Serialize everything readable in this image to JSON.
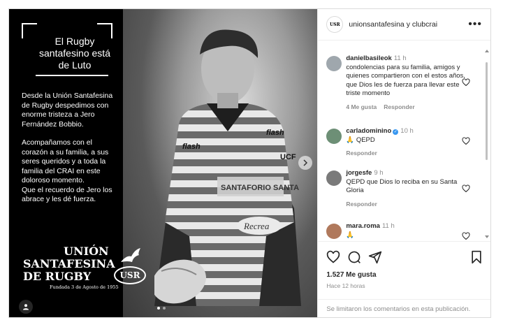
{
  "post": {
    "overlay_title": "El Rugby santafesino está de Luto",
    "paragraph1": "Desde la Unión Santafesina de Rugby despedimos con enorme tristeza a Jero Fernández Bobbio.",
    "paragraph2": "Acompañamos con el corazón a su familia, a sus seres queridos y a toda la familia del CRAI en este doloroso momento.",
    "paragraph3": "Que el recuerdo de Jero los abrace y les dé fuerza.",
    "logo": {
      "line1": "UNIÓN",
      "line2": "SANTAFESINA",
      "line3": "DE RUGBY",
      "badge": "USR",
      "founded": "Fundada 3 de Agosto de 1955"
    },
    "jersey": {
      "brand": "flash",
      "chest": "SANTAFORIO SANTA FE",
      "sponsor": "Recrea",
      "sleeve": "UCF"
    }
  },
  "header": {
    "author": "unionsantafesina",
    "connector": "y",
    "collaborator": "clubcrai",
    "avatar_text": "USR",
    "more_label": "•••"
  },
  "comments": [
    {
      "user": "danielbasileok",
      "time": "11 h",
      "text": "condolencias para su familia, amigos y quienes compartieron con el estos años, que Dios les de fuerza para llevar este triste momento",
      "likes": "4 Me gusta",
      "reply": "Responder"
    },
    {
      "user": "carladominino",
      "verified": true,
      "time": "10 h",
      "text": "🙏 QEPD",
      "reply": "Responder"
    },
    {
      "user": "jorgesfe",
      "time": "9 h",
      "text": "QEPD que Dios lo reciba en su Santa Gloria",
      "reply": "Responder"
    },
    {
      "user": "mara.roma",
      "time": "11 h",
      "text": "🙏"
    }
  ],
  "footer": {
    "likes": "1.527 Me gusta",
    "time_ago": "Hace 12 horas",
    "comments_limited": "Se limitaron los comentarios en esta publicación."
  },
  "colors": {
    "verified_blue": "#3897f0",
    "text_dark": "#262626",
    "text_muted": "#8e8e8e",
    "border": "#dbdbdb"
  },
  "icons": [
    "heart-icon",
    "comment-icon",
    "share-icon",
    "bookmark-icon",
    "more-icon",
    "user-tag-icon",
    "next-arrow-icon"
  ]
}
